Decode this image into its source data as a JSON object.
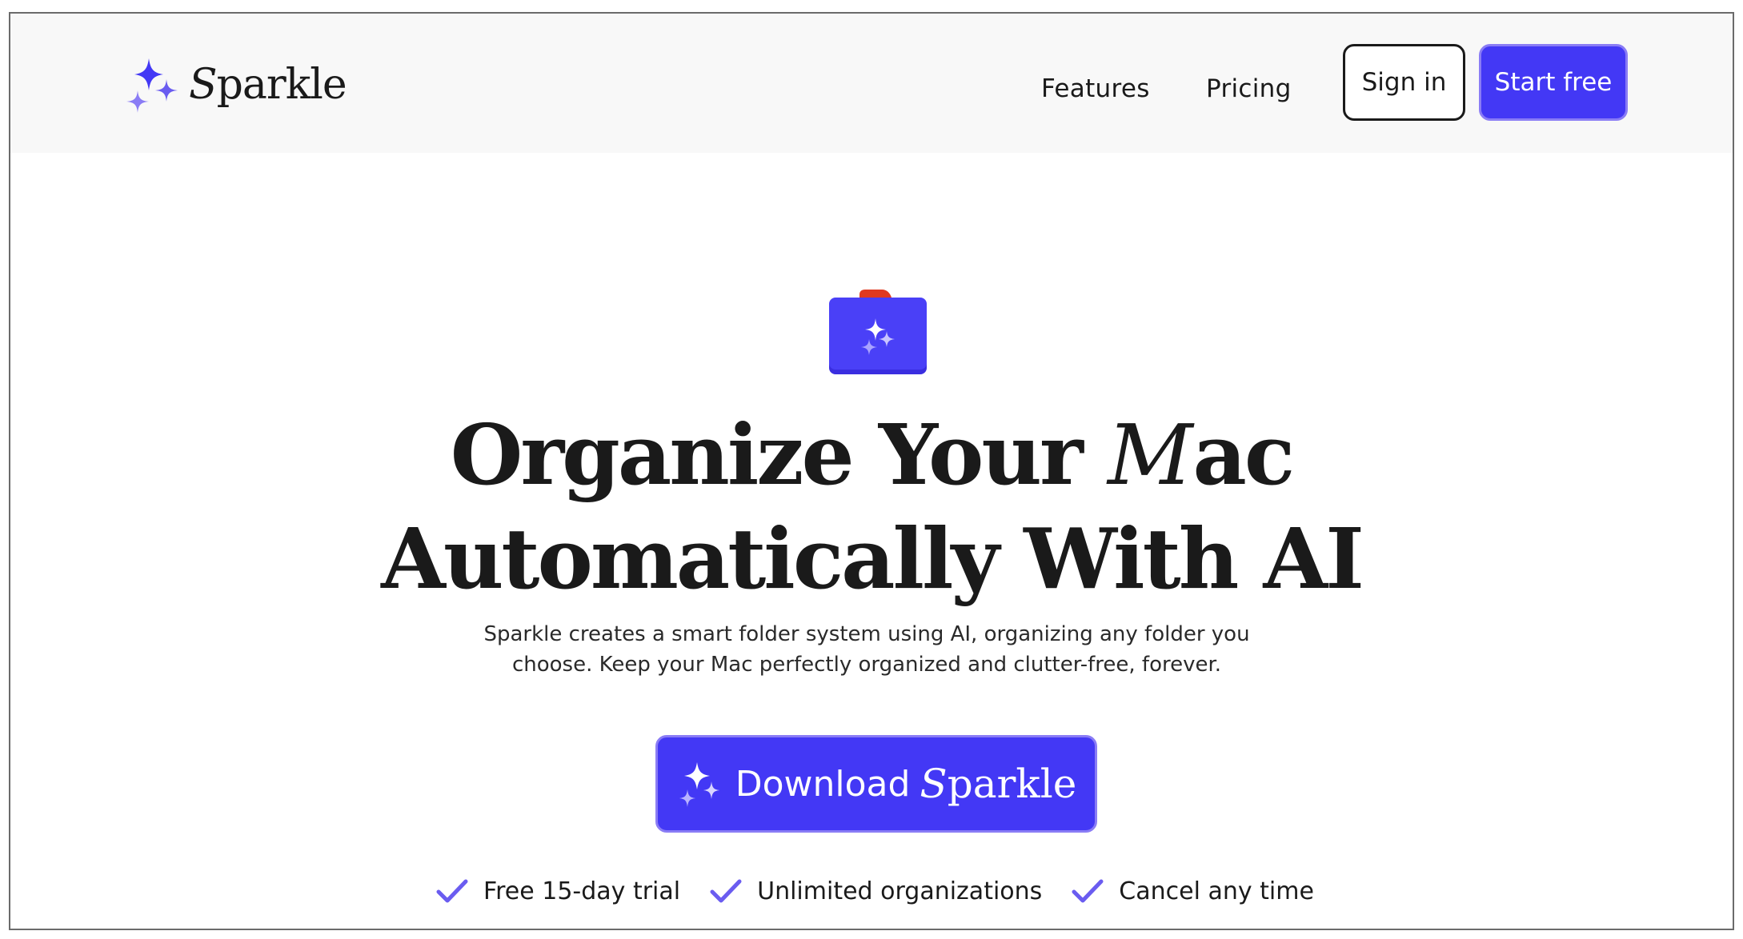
{
  "header": {
    "brand": {
      "initial": "S",
      "rest": "parkle",
      "icon": "sparkle-icon"
    },
    "nav": [
      {
        "label": "Features"
      },
      {
        "label": "Pricing"
      }
    ],
    "sign_in_label": "Sign in",
    "start_free_label": "Start free"
  },
  "hero": {
    "icon": "folder-sparkle-icon",
    "headline_line1_pre": "Organize Your ",
    "headline_line1_script": "M",
    "headline_line1_post": "ac",
    "headline_line2": "Automatically With AI",
    "subtitle": "Sparkle creates a smart folder system using AI, organizing any folder you choose.  Keep your Mac perfectly organized and clutter-free, forever.",
    "download": {
      "label": "Download",
      "brand_initial": "S",
      "brand_rest": "parkle",
      "icon": "sparkle-icon"
    },
    "perks": [
      {
        "icon": "check-icon",
        "label": "Free 15-day trial"
      },
      {
        "icon": "check-icon",
        "label": "Unlimited organizations"
      },
      {
        "icon": "check-icon",
        "label": "Cancel any time"
      }
    ]
  },
  "colors": {
    "accent": "#4338f5",
    "accent_border": "#8a7cf5",
    "check": "#6a5cf0",
    "folder_tab": "#e0391f",
    "header_bg": "#f8f8f8",
    "text": "#1a1a1a"
  }
}
